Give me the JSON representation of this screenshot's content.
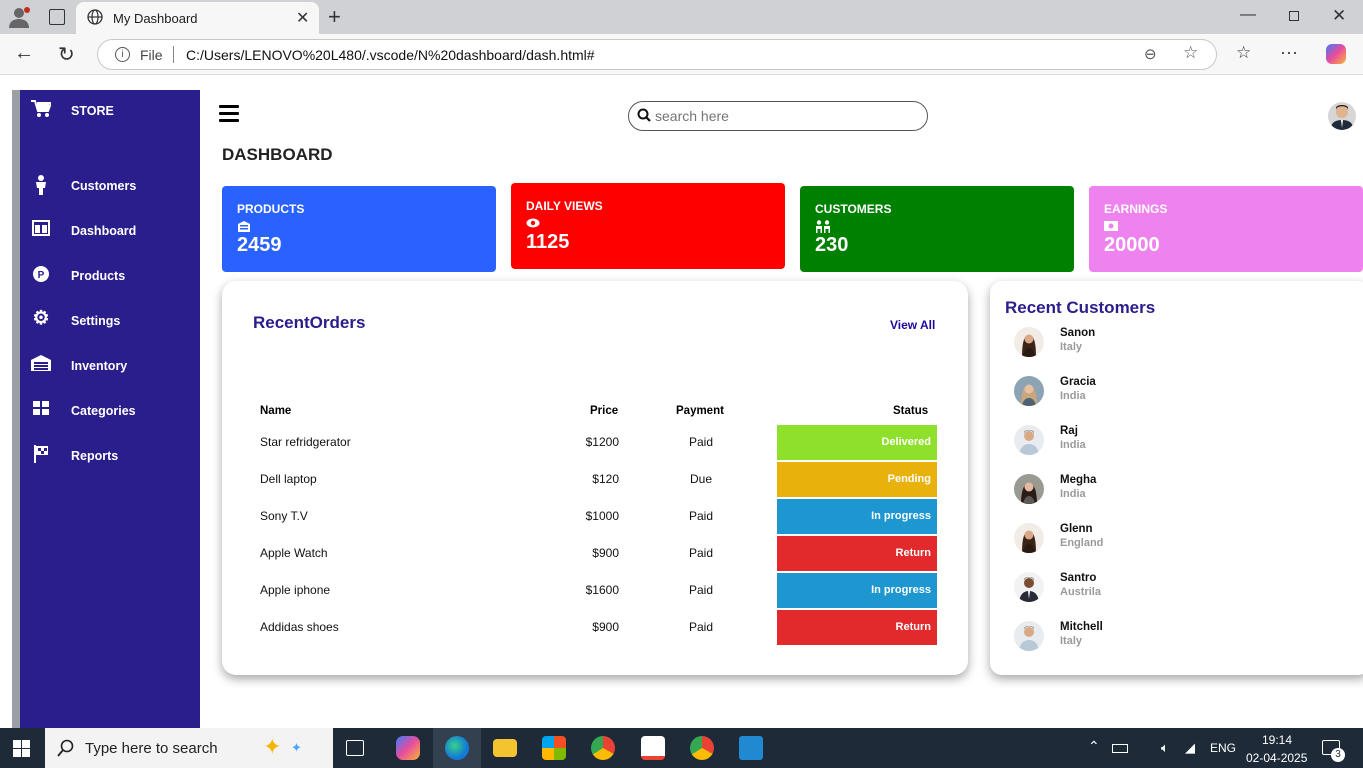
{
  "browser": {
    "tab_title": "My Dashboard",
    "url_prefix": "File",
    "url": "C:/Users/LENOVO%20L480/.vscode/N%20dashboard/dash.html#"
  },
  "sidebar": {
    "brand": "STORE",
    "items": [
      {
        "label": "Customers",
        "icon": "person-icon"
      },
      {
        "label": "Dashboard",
        "icon": "dashboard-icon"
      },
      {
        "label": "Products",
        "icon": "product-icon"
      },
      {
        "label": "Settings",
        "icon": "gear-icon"
      },
      {
        "label": "Inventory",
        "icon": "warehouse-icon"
      },
      {
        "label": "Categories",
        "icon": "grid-icon"
      },
      {
        "label": "Reports",
        "icon": "flag-icon"
      }
    ]
  },
  "header": {
    "search_placeholder": "search here",
    "page_title": "DASHBOARD"
  },
  "cards": [
    {
      "title": "PRODUCTS",
      "value": "2459",
      "color": "#2962ff",
      "icon": "box-icon"
    },
    {
      "title": "DAILY VIEWS",
      "value": "1125",
      "color": "#ff0000",
      "icon": "eye-icon"
    },
    {
      "title": "CUSTOMERS",
      "value": "230",
      "color": "#008000",
      "icon": "people-icon"
    },
    {
      "title": "EARNINGS",
      "value": "20000",
      "color": "#ee82ee",
      "icon": "money-icon"
    }
  ],
  "orders": {
    "title": "RecentOrders",
    "view_all": "View All",
    "columns": [
      "Name",
      "Price",
      "Payment",
      "Status"
    ],
    "rows": [
      {
        "name": "Star refridgerator",
        "price": "$1200",
        "payment": "Paid",
        "status": "Delivered",
        "color": "#8ee02a"
      },
      {
        "name": "Dell laptop",
        "price": "$120",
        "payment": "Due",
        "status": "Pending",
        "color": "#e9b10c"
      },
      {
        "name": "Sony T.V",
        "price": "$1000",
        "payment": "Paid",
        "status": "In progress",
        "color": "#1e96d0"
      },
      {
        "name": "Apple Watch",
        "price": "$900",
        "payment": "Paid",
        "status": "Return",
        "color": "#e2292c"
      },
      {
        "name": "Apple iphone",
        "price": "$1600",
        "payment": "Paid",
        "status": "In progress",
        "color": "#1e96d0"
      },
      {
        "name": "Addidas shoes",
        "price": "$900",
        "payment": "Paid",
        "status": "Return",
        "color": "#e2292c"
      }
    ]
  },
  "recent_customers": {
    "title": "Recent Customers",
    "items": [
      {
        "name": "Sanon",
        "country": "Italy"
      },
      {
        "name": "Gracia",
        "country": "India"
      },
      {
        "name": "Raj",
        "country": "India"
      },
      {
        "name": "Megha",
        "country": "India"
      },
      {
        "name": "Glenn",
        "country": "England"
      },
      {
        "name": "Santro",
        "country": "Austrila"
      },
      {
        "name": "Mitchell",
        "country": "Italy"
      }
    ]
  },
  "taskbar": {
    "search_text": "Type here to search",
    "lang": "ENG",
    "time": "19:14",
    "date": "02-04-2025",
    "notifications": "3"
  }
}
